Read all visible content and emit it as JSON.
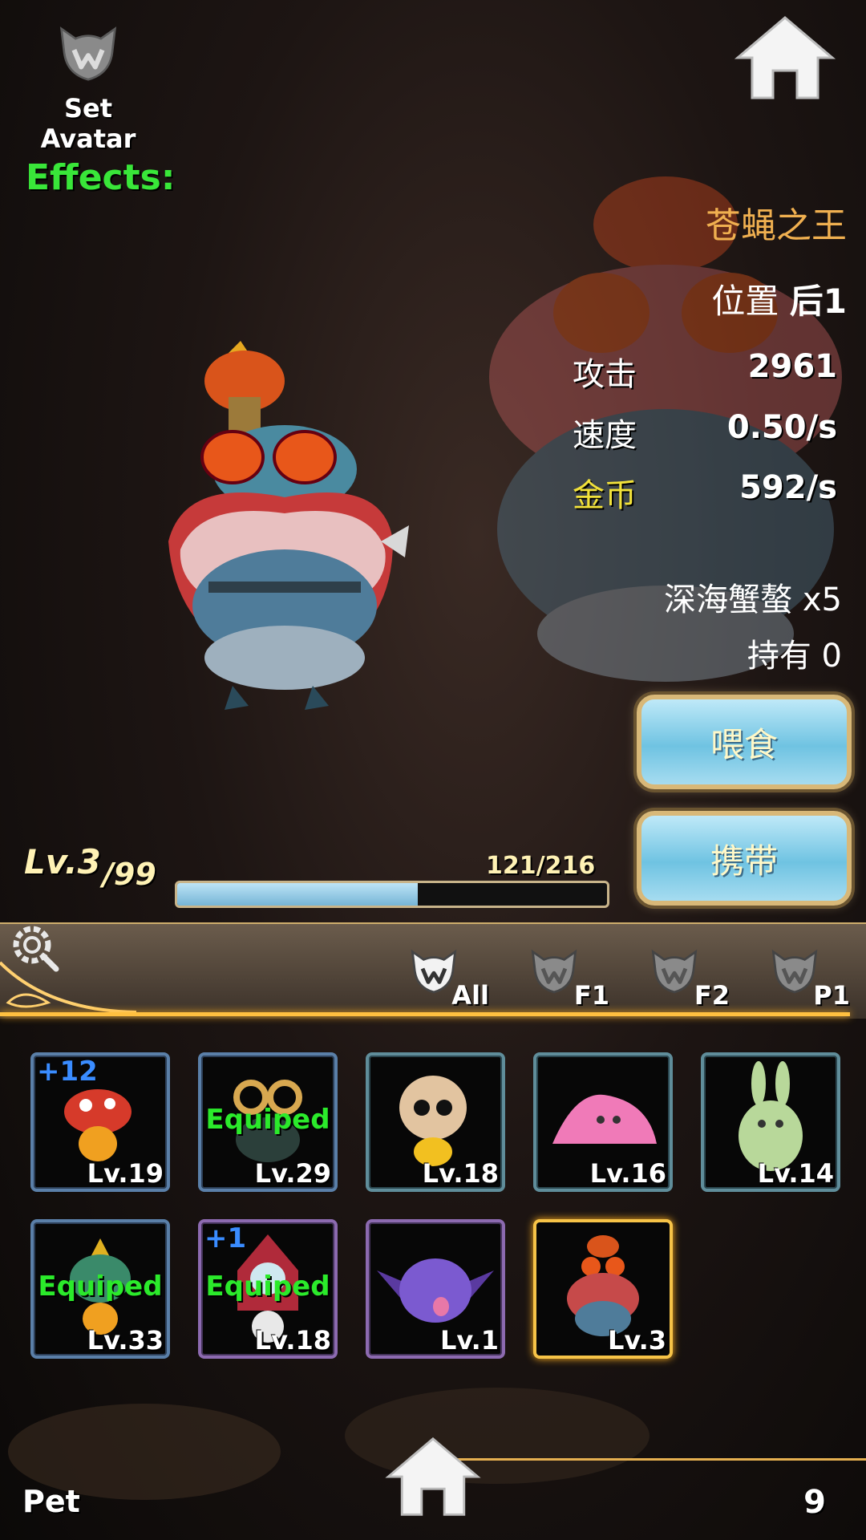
{
  "header": {
    "avatar_label": "Set Avatar",
    "effects_label": "Effects:",
    "avatar_icon": "wolf-emblem-icon",
    "home_icon": "home-icon"
  },
  "pet_detail": {
    "name": "苍蝇之王",
    "position_label": "位置",
    "position_value": "后1",
    "stats": [
      {
        "label": "攻击",
        "value": "2961",
        "label_color": "#ffffff"
      },
      {
        "label": "速度",
        "value": "0.50/s",
        "label_color": "#ffffff"
      },
      {
        "label": "金币",
        "value": "592/s",
        "label_color": "#f2e23a"
      }
    ],
    "food_text": "深海蟹螯 x5",
    "owned_text": "持有 0",
    "feed_button": "喂食",
    "carry_button": "携带",
    "level": "Lv.3",
    "level_max": "/99",
    "xp_text": "121/216",
    "xp_fraction": 0.56
  },
  "filters": {
    "settings_icon": "gear-search-icon",
    "tabs": [
      {
        "label": "All",
        "active": true
      },
      {
        "label": "F1",
        "active": false
      },
      {
        "label": "F2",
        "active": false
      },
      {
        "label": "P1",
        "active": false
      }
    ]
  },
  "pets": [
    {
      "level": "Lv.19",
      "plus": "+12",
      "equipped": "",
      "frame": "blue",
      "icon": "mushroom-pet-icon"
    },
    {
      "level": "Lv.29",
      "plus": "",
      "equipped": "Equiped",
      "frame": "blue",
      "icon": "goggles-pet-icon"
    },
    {
      "level": "Lv.18",
      "plus": "",
      "equipped": "",
      "frame": "teal",
      "icon": "eggshell-chick-pet-icon"
    },
    {
      "level": "Lv.16",
      "plus": "",
      "equipped": "",
      "frame": "teal",
      "icon": "pink-slime-pet-icon"
    },
    {
      "level": "Lv.14",
      "plus": "",
      "equipped": "",
      "frame": "teal",
      "icon": "green-rabbit-pet-icon"
    },
    {
      "level": "Lv.33",
      "plus": "",
      "equipped": "Equiped",
      "frame": "blue",
      "icon": "leaf-sprout-pet-icon"
    },
    {
      "level": "Lv.18",
      "plus": "+1",
      "equipped": "Equiped",
      "frame": "purple",
      "icon": "hooded-skull-pet-icon"
    },
    {
      "level": "Lv.1",
      "plus": "",
      "equipped": "",
      "frame": "purple",
      "icon": "purple-bat-slime-pet-icon"
    },
    {
      "level": "Lv.3",
      "plus": "",
      "equipped": "",
      "frame": "selected",
      "icon": "fly-king-pet-icon"
    }
  ],
  "footer": {
    "title": "Pet",
    "count": "9"
  }
}
